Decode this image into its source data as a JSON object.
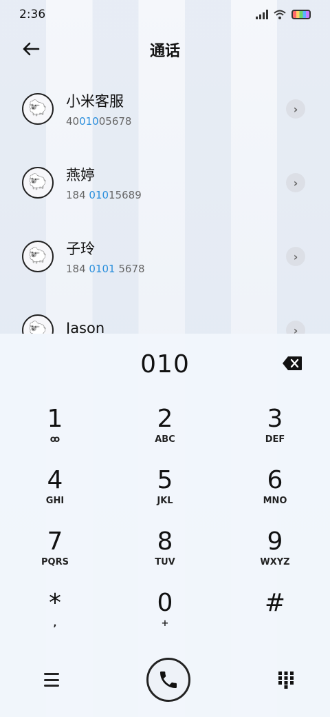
{
  "status": {
    "time": "2:36"
  },
  "header": {
    "title": "通话"
  },
  "contacts": [
    {
      "name": "小米客服",
      "number_pre": "40",
      "number_match": "010",
      "number_post": "05678"
    },
    {
      "name": "燕婷",
      "number_pre": "184 ",
      "number_match": "010",
      "number_post": "15689"
    },
    {
      "name": "子玲",
      "number_pre": "184 ",
      "number_match": "0101",
      "number_post": " 5678"
    },
    {
      "name": "Jason",
      "number_pre": "",
      "number_match": "",
      "number_post": ""
    }
  ],
  "dialer": {
    "number": "010",
    "keys": [
      {
        "digit": "1",
        "letters": "ꝏ"
      },
      {
        "digit": "2",
        "letters": "ABC"
      },
      {
        "digit": "3",
        "letters": "DEF"
      },
      {
        "digit": "4",
        "letters": "GHI"
      },
      {
        "digit": "5",
        "letters": "JKL"
      },
      {
        "digit": "6",
        "letters": "MNO"
      },
      {
        "digit": "7",
        "letters": "PQRS"
      },
      {
        "digit": "8",
        "letters": "TUV"
      },
      {
        "digit": "9",
        "letters": "WXYZ"
      },
      {
        "digit": "*",
        "letters": ","
      },
      {
        "digit": "0",
        "letters": "+"
      },
      {
        "digit": "#",
        "letters": ""
      }
    ]
  },
  "icons": {
    "back": "arrow-left-icon",
    "delete": "backspace-icon",
    "menu": "menu-icon",
    "call": "phone-icon",
    "dialpad": "dialpad-icon"
  }
}
